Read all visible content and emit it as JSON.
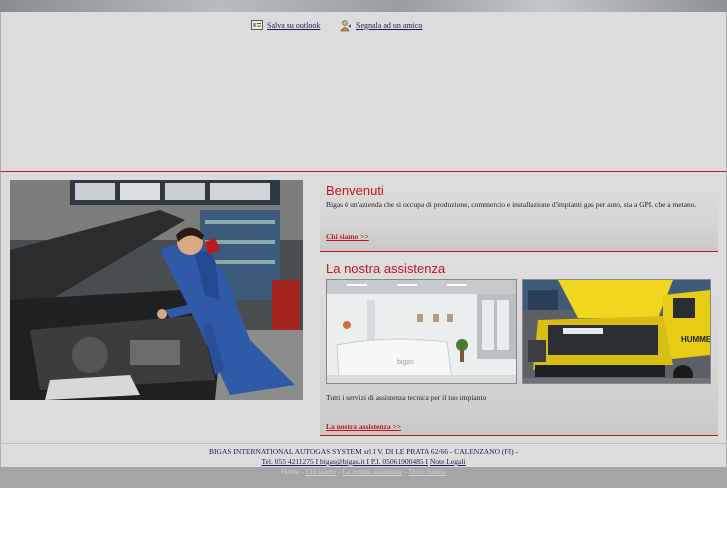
{
  "header": {
    "save_outlook": "Salva su outlook",
    "recommend_friend": "Segnala ad un amico"
  },
  "welcome": {
    "title": "Benvenuti",
    "text": "Bigas è un'azienda che si occupa di produzione, commercio e installazione d'impianti gas per auto, sia a GPL che a metano.",
    "link": "Chi siamo >>"
  },
  "assistance": {
    "title": "La nostra assistenza",
    "text": "Tutti i servizi di assistenza tecnica per il tuo impianto",
    "link": "La nostra assistenza >>"
  },
  "footer": {
    "line1": "BIGAS INTERNATIONAL AUTOGAS SYSTEM srl I V. DI LE PRATA 62/66 - CALENZANO (FI) -",
    "contacts": "Tel. 055 4211275 I bigas@bigas.it I P.I. 05061900485 I",
    "legal": "Note Legali"
  },
  "nav": {
    "home": "Home",
    "sep": "-",
    "about": "Chi siamo",
    "assistance": "La nostra assistenza",
    "dove": "Dove Siamo"
  },
  "photos": {
    "reception_sign": "bigas",
    "hood_brand": "HUMMER"
  },
  "colors": {
    "accent": "#c0161e",
    "panel": "#dcdcdc",
    "link": "#1a1a5a"
  }
}
